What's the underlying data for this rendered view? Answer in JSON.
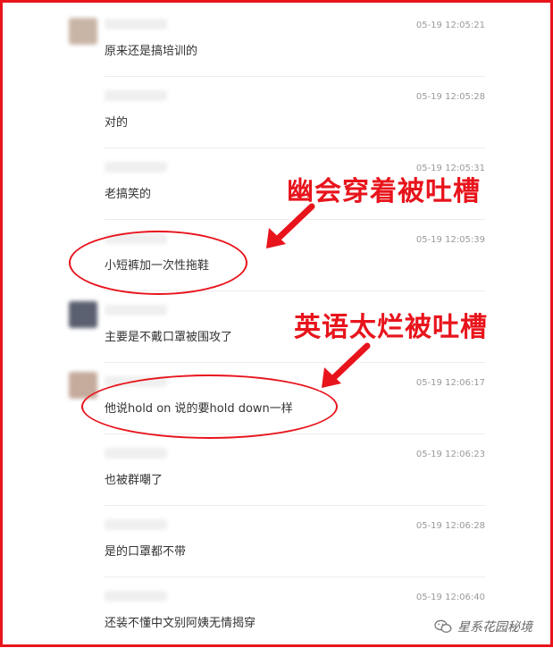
{
  "comments": [
    {
      "time": "05-19 12:05:21",
      "text": "原来还是搞培训的"
    },
    {
      "time": "05-19 12:05:28",
      "text": "对的"
    },
    {
      "time": "05-19 12:05:31",
      "text": "老搞笑的"
    },
    {
      "time": "05-19 12:05:39",
      "text": "小短裤加一次性拖鞋"
    },
    {
      "time": "",
      "text": "主要是不戴口罩被围攻了"
    },
    {
      "time": "05-19 12:06:17",
      "text": "他说hold on 说的要hold down一样"
    },
    {
      "time": "05-19 12:06:23",
      "text": "也被群嘲了"
    },
    {
      "time": "05-19 12:06:28",
      "text": "是的口罩都不带"
    },
    {
      "time": "05-19 12:06:40",
      "text": "还装不懂中文别阿姨无情揭穿"
    }
  ],
  "annotations": {
    "first": "幽会穿着被吐槽",
    "second": "英语太烂被吐槽"
  },
  "watermark": {
    "text": "星系花园秘境",
    "icon": "wechat-icon"
  },
  "colors": {
    "accent": "#e8141c",
    "text": "#333333",
    "time": "#9a9a9a"
  }
}
